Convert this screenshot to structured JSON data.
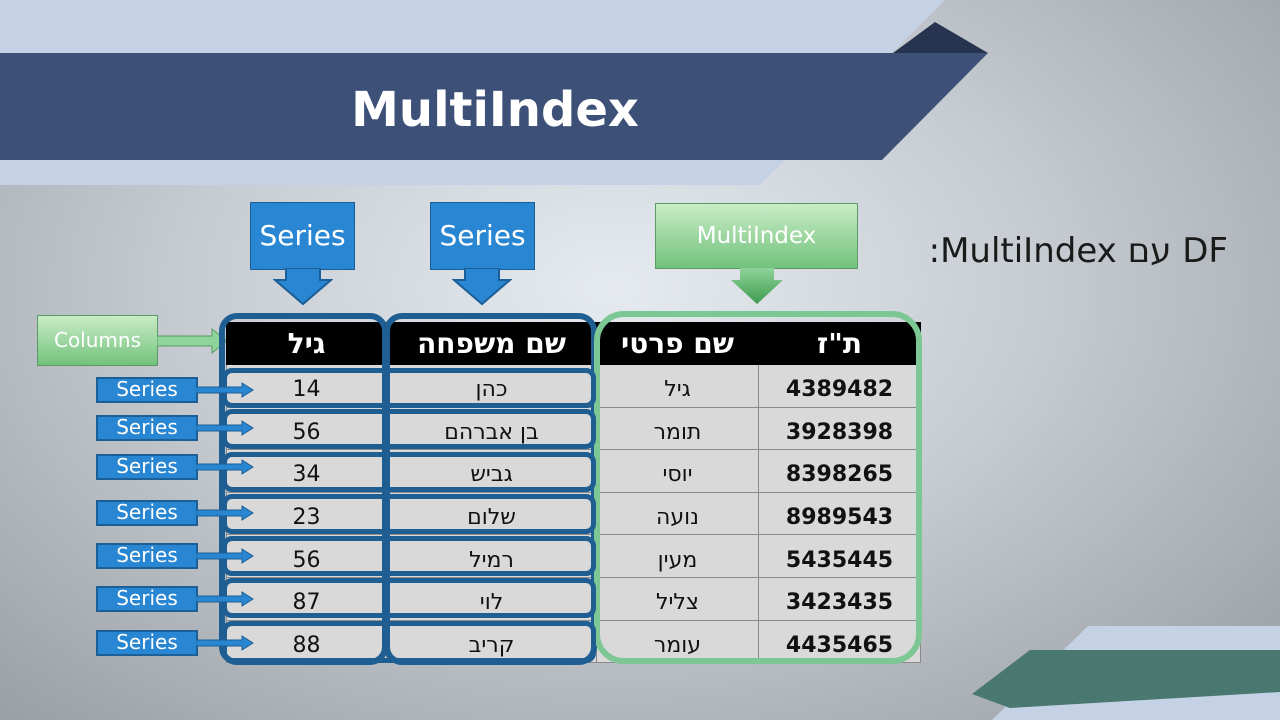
{
  "slide": {
    "title": "MultiIndex",
    "subtitle": "DF עם MultiIndex:"
  },
  "colors": {
    "title_band": "#3d5178",
    "light_band": "#c5d2e6",
    "series_blue": "#2886d2",
    "series_outline": "#1f5e93",
    "multiindex_green": "#7dc795",
    "teal_band": "#48786f",
    "table_header": "#000000",
    "table_cell": "#d9d9d9"
  },
  "callouts": {
    "series_top_1": "Series",
    "series_top_2": "Series",
    "multiindex": "MultiIndex",
    "columns": "Columns",
    "row_series_label": "Series"
  },
  "table": {
    "headers": [
      "גיל",
      "שם משפחה",
      "שם פרטי",
      "ת\"ז"
    ],
    "rows": [
      [
        "14",
        "כהן",
        "גיל",
        "4389482"
      ],
      [
        "56",
        "בן אברהם",
        "תומר",
        "3928398"
      ],
      [
        "34",
        "גביש",
        "יוסי",
        "8398265"
      ],
      [
        "23",
        "שלום",
        "נועה",
        "8989543"
      ],
      [
        "56",
        "רמיל",
        "מעין",
        "5435445"
      ],
      [
        "87",
        "לוי",
        "צליל",
        "3423435"
      ],
      [
        "88",
        "קריב",
        "עומר",
        "4435465"
      ]
    ]
  },
  "icons": {
    "arrow_down": "arrow-down-icon",
    "arrow_right": "arrow-right-icon"
  }
}
